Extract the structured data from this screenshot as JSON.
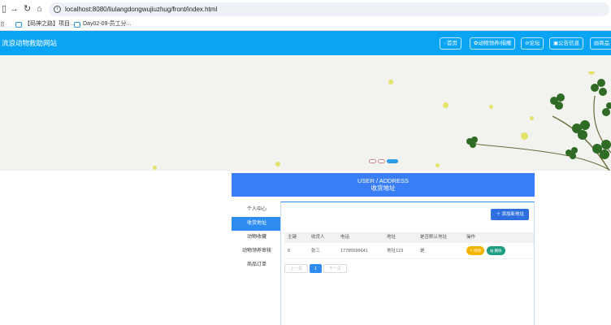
{
  "browser": {
    "url": "localhost:8080/liulangdongwujiuzhug/front/index.html",
    "bookmarks": [
      "【码神之路】项目...",
      "Day02-09-员工分..."
    ]
  },
  "header": {
    "logo": "流浪动物救助网站",
    "menu": [
      "首页",
      "动物领养/捐赠",
      "论坛",
      "公告信息",
      "商品"
    ]
  },
  "title_bar": {
    "line1": "USER / ADDRESS",
    "line2": "收货地址"
  },
  "sidebar": {
    "items": [
      "个人中心",
      "收货地址",
      "动物收藏",
      "动物领养审核",
      "商品订单"
    ],
    "active_index": 1
  },
  "panel": {
    "add_button": "添加新地址",
    "columns": [
      "主键",
      "收货人",
      "电话",
      "地址",
      "是否默认地址",
      "操作"
    ],
    "rows": [
      {
        "id": "6",
        "name": "张三",
        "phone": "17785599641",
        "address": "地址123",
        "default": "是"
      }
    ],
    "edit_label": "修改",
    "delete_label": "删除",
    "pager": {
      "prev": "上一页",
      "current": "1",
      "next": "下一页"
    }
  },
  "colors": {
    "header_bg": "#0aa4f5",
    "title_bar_bg": "#3a7ef5",
    "active_blue": "#2e8cf0",
    "edit_btn": "#f5b400",
    "delete_btn": "#1d9d82"
  }
}
